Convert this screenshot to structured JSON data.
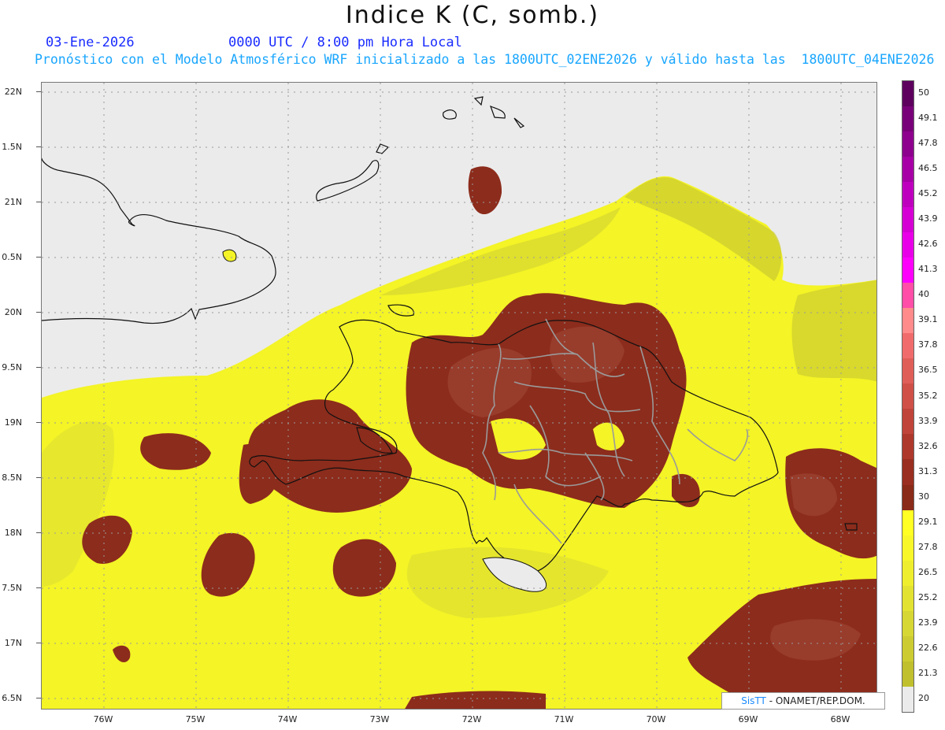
{
  "title": "Indice K (C, somb.)",
  "date": "03-Ene-2026",
  "time": "0000 UTC / 8:00 pm Hora Local",
  "forecast": "Pronóstico con el Modelo Atmosférico WRF inicializado a las 1800UTC_02ENE2026 y válido hasta las  1800UTC_04ENE2026",
  "lat_labels": [
    "22N",
    "1.5N",
    "21N",
    "0.5N",
    "20N",
    "9.5N",
    "19N",
    "8.5N",
    "18N",
    "7.5N",
    "17N",
    "6.5N"
  ],
  "lon_labels": [
    "76W",
    "75W",
    "74W",
    "73W",
    "72W",
    "71W",
    "70W",
    "69W",
    "68W"
  ],
  "colorbar": {
    "labels": [
      "50",
      "49.1",
      "47.8",
      "46.5",
      "45.2",
      "43.9",
      "42.6",
      "41.3",
      "40",
      "39.1",
      "37.8",
      "36.5",
      "35.2",
      "33.9",
      "32.6",
      "31.3",
      "30",
      "29.1",
      "27.8",
      "26.5",
      "25.2",
      "23.9",
      "22.6",
      "21.3",
      "20"
    ],
    "colors": [
      "#5e005e",
      "#780078",
      "#8e008e",
      "#a600a6",
      "#be00be",
      "#d400d4",
      "#e800e8",
      "#fc00fc",
      "#ff4ea8",
      "#ff8b8b",
      "#f06c6c",
      "#e05e58",
      "#d05048",
      "#c0443a",
      "#ae382c",
      "#9a2e20",
      "#8a2a18",
      "#ffff24",
      "#f7f72a",
      "#eeee2e",
      "#e2e232",
      "#d6d634",
      "#cccc32",
      "#c0c02e",
      "#ebebeb"
    ]
  },
  "credit": {
    "brand": "SisTT",
    "text": " - ONAMET/REP.DOM."
  }
}
